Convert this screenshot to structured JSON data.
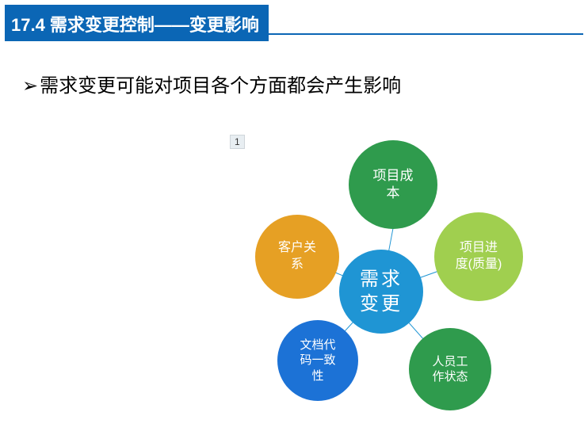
{
  "header": {
    "title": "17.4 需求变更控制——变更影响"
  },
  "bullet": {
    "marker": "➢",
    "text": "需求变更可能对项目各个方面都会产生影响"
  },
  "page_number": "1",
  "diagram": {
    "center": "需求\n变更",
    "nodes": {
      "cost": "项目成\n本",
      "customer": "客户关\n系",
      "progress": "项目进\n度(质量)",
      "doc": "文档代\n码一致\n性",
      "staff": "人员工\n作状态"
    }
  }
}
